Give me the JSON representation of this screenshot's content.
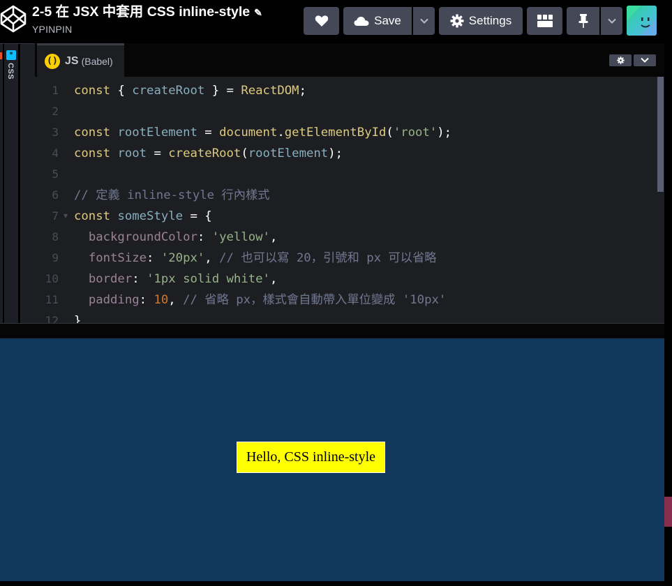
{
  "header": {
    "title": "2-5 在 JSX 中套用 CSS inline-style",
    "author": "YPINPIN",
    "buttons": {
      "save_label": "Save",
      "settings_label": "Settings"
    },
    "icons": [
      "codepen-logo-icon",
      "pencil-icon",
      "heart-icon",
      "cloud-icon",
      "chevron-down-icon",
      "gear-icon",
      "layout-icon",
      "pin-icon",
      "avatar"
    ]
  },
  "left_panes": {
    "css_label": "CSS",
    "css_icon_glyph": "*"
  },
  "editor": {
    "language_label": "JS",
    "language_sub": "(Babel)",
    "icon_glyph": "()",
    "line_numbers": [
      "1",
      "2",
      "3",
      "4",
      "5",
      "6",
      "7",
      "8",
      "9",
      "10",
      "11",
      "12"
    ],
    "code_lines": [
      "const { createRoot } = ReactDOM;",
      "",
      "const rootElement = document.getElementById('root');",
      "const root = createRoot(rootElement);",
      "",
      "// 定義 inline-style 行內樣式",
      "const someStyle = {",
      "  backgroundColor: 'yellow',",
      "  fontSize: '20px', // 也可以寫 20，引號和 px 可以省略",
      "  border: '1px solid white',",
      "  padding: 10, // 省略 px，樣式會自動帶入單位變成 '10px'",
      "}"
    ]
  },
  "result": {
    "hello_text": "Hello, CSS inline-style",
    "background": "#12375c",
    "box_background": "#ffff00"
  },
  "colors": {
    "header_bg": "#000000",
    "button_bg": "#444857",
    "editor_bg": "#1d1e22",
    "keyword": "#ddca7e",
    "variable": "#88afbf",
    "string": "#96b38a",
    "comment": "#717790",
    "number": "#d0782a"
  }
}
